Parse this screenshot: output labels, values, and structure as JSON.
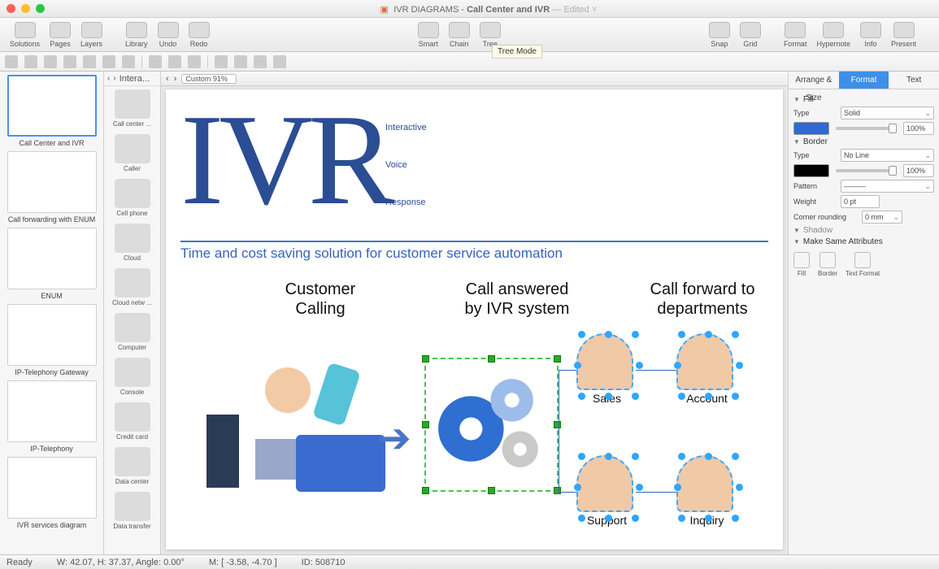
{
  "window": {
    "title_prefix": "IVR DIAGRAMS - ",
    "title": "Call Center and IVR",
    "edited": " — Edited"
  },
  "toolbar": {
    "left": [
      {
        "l": "Solutions"
      },
      {
        "l": "Pages"
      },
      {
        "l": "Layers"
      }
    ],
    "left2": [
      {
        "l": "Library"
      },
      {
        "l": "Undo"
      },
      {
        "l": "Redo"
      }
    ],
    "center": [
      {
        "l": "Smart"
      },
      {
        "l": "Chain"
      },
      {
        "l": "Tree"
      }
    ],
    "right": [
      {
        "l": "Snap"
      },
      {
        "l": "Grid"
      }
    ],
    "right2": [
      {
        "l": "Format"
      },
      {
        "l": "Hypernote"
      },
      {
        "l": "Info"
      },
      {
        "l": "Present"
      }
    ],
    "tooltip": "Tree Mode"
  },
  "pages": [
    {
      "l": "Call Center and IVR",
      "sel": true
    },
    {
      "l": "Call forwarding with ENUM"
    },
    {
      "l": "ENUM"
    },
    {
      "l": "IP-Telephony Gateway"
    },
    {
      "l": "IP-Telephony"
    },
    {
      "l": "IVR services diagram"
    }
  ],
  "library": {
    "tab": "Intera...",
    "items": [
      {
        "l": "Call center ..."
      },
      {
        "l": "Caller"
      },
      {
        "l": "Cell phone"
      },
      {
        "l": "Cloud"
      },
      {
        "l": "Cloud netw ..."
      },
      {
        "l": "Computer"
      },
      {
        "l": "Console"
      },
      {
        "l": "Credit card"
      },
      {
        "l": "Data center"
      },
      {
        "l": "Data transfer"
      }
    ]
  },
  "canvas": {
    "zoom": "Custom 91%",
    "ivr": "IVR",
    "words": [
      "Interactive",
      "Voice",
      "Response"
    ],
    "tagline": "Time and cost saving solution for customer service automation",
    "cols": [
      "Customer\nCalling",
      "Call answered\nby IVR system",
      "Call forward to\ndepartments"
    ],
    "agents": [
      "Sales",
      "Account",
      "Support",
      "Inquiry"
    ]
  },
  "inspector": {
    "tabs": [
      "Arrange & Size",
      "Format",
      "Text"
    ],
    "active": 1,
    "fill": {
      "h": "Fill",
      "type": "Solid",
      "opacity": "100%",
      "color": "#2e69d6"
    },
    "border": {
      "h": "Border",
      "type": "No Line",
      "opacity": "100%",
      "color": "#000000",
      "pattern": "Pattern",
      "patternval": "———",
      "weight": "Weight",
      "weightval": "0 pt",
      "corner": "Corner rounding",
      "cornerval": "0 mm"
    },
    "shadow": "Shadow",
    "make": "Make Same Attributes",
    "makeitems": [
      "Fill",
      "Border",
      "Text Format"
    ],
    "typelbl": "Type"
  },
  "status": {
    "ready": "Ready",
    "dims": "W: 42.07, H: 37.37, Angle: 0.00°",
    "mouse": "M: [ -3.58, -4.70 ]",
    "id": "ID: 508710"
  }
}
